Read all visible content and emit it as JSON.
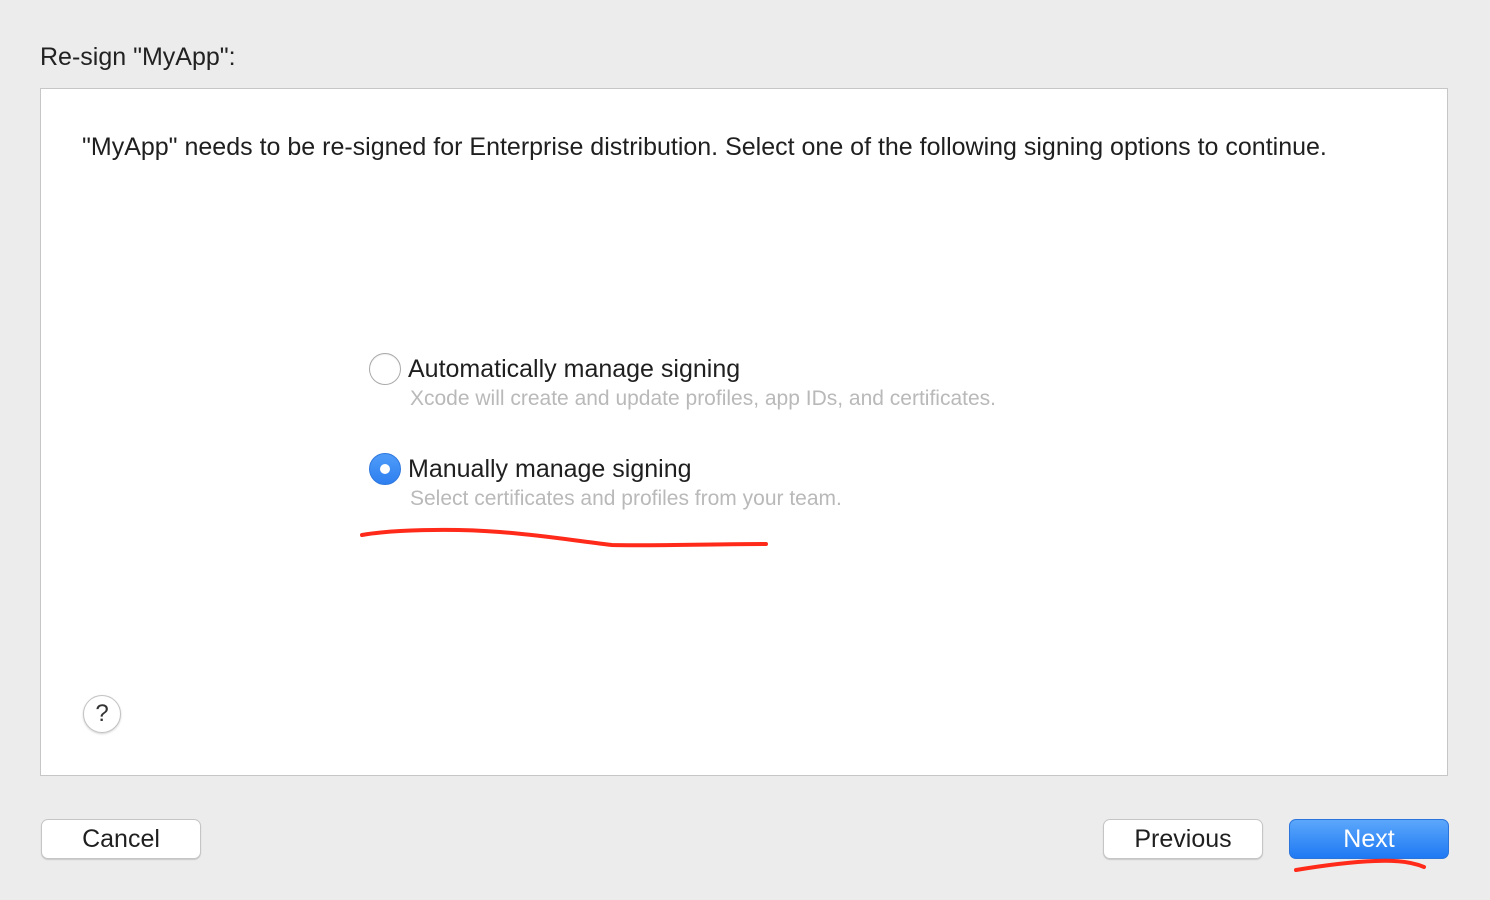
{
  "sheet": {
    "title": "Re-sign \"MyApp\":"
  },
  "panel": {
    "description": "\"MyApp\" needs to be re-signed for Enterprise distribution. Select one of the following signing options to continue.",
    "options": [
      {
        "label": "Automatically manage signing",
        "subtitle": "Xcode will create and update profiles, app IDs, and certificates.",
        "selected": false
      },
      {
        "label": "Manually manage signing",
        "subtitle": "Select certificates and profiles from your team.",
        "selected": true
      }
    ],
    "help": {
      "label": "?",
      "icon": "question-mark-icon"
    }
  },
  "buttons": {
    "cancel": "Cancel",
    "previous": "Previous",
    "next": "Next"
  },
  "colors": {
    "accent": "#2e7ff0",
    "annotation": "#ff2a1a",
    "subtitle_text": "#b9b9b9"
  }
}
